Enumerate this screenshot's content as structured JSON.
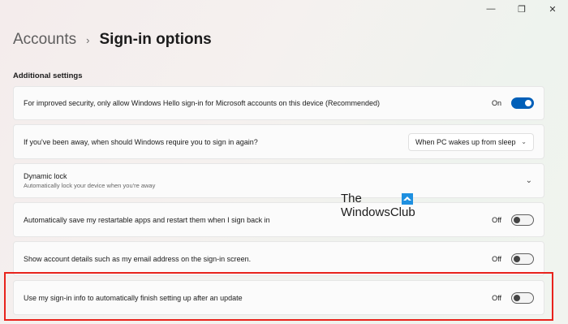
{
  "window": {
    "minimize_glyph": "—",
    "maximize_glyph": "❐",
    "close_glyph": "✕"
  },
  "breadcrumb": {
    "parent": "Accounts",
    "separator": "›",
    "current": "Sign-in options"
  },
  "section": {
    "title": "Additional settings"
  },
  "settings": [
    {
      "label": "For improved security, only allow Windows Hello sign-in for Microsoft accounts on this device (Recommended)",
      "state_label": "On",
      "state": "on"
    },
    {
      "label": "If you've been away, when should Windows require you to sign in again?",
      "dropdown_value": "When PC wakes up from sleep"
    },
    {
      "label": "Dynamic lock",
      "description": "Automatically lock your device when you're away"
    },
    {
      "label": "Automatically save my restartable apps and restart them when I sign back in",
      "state_label": "Off",
      "state": "off"
    },
    {
      "label": "Show account details such as my email address on the sign-in screen.",
      "state_label": "Off",
      "state": "off"
    },
    {
      "label": "Use my sign-in info to automatically finish setting up after an update",
      "state_label": "Off",
      "state": "off"
    }
  ],
  "watermark": {
    "line1": "The",
    "line2": "WindowsClub"
  },
  "colors": {
    "accent": "#005fb8",
    "highlight_box": "#e8231c"
  }
}
